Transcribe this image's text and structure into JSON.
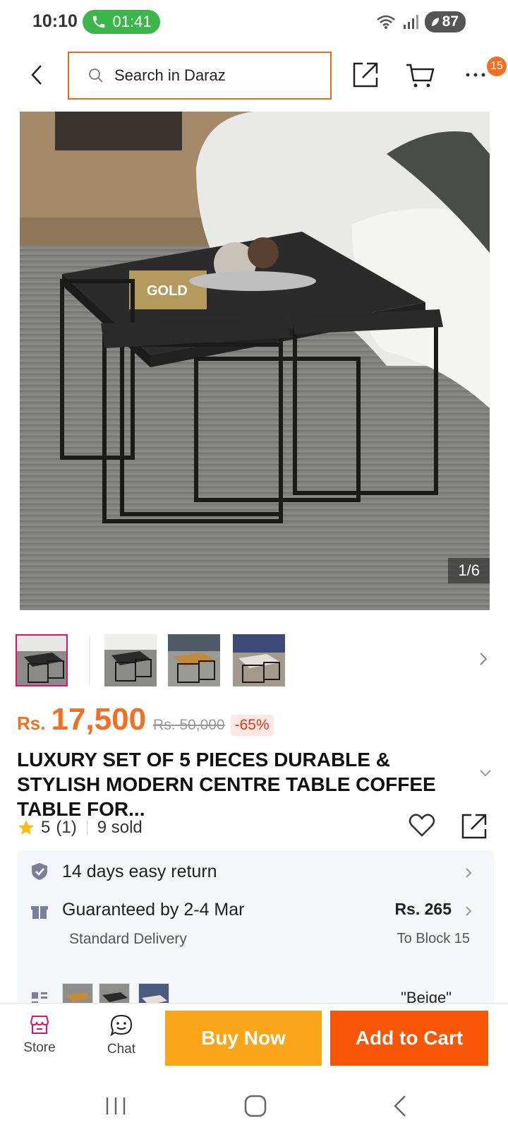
{
  "status_bar": {
    "time": "10:10",
    "call_duration": "01:41",
    "battery": "87"
  },
  "header": {
    "search_placeholder": "Search in Daraz",
    "more_badge": "15"
  },
  "gallery": {
    "counter": "1/6"
  },
  "product": {
    "currency": "Rs.",
    "price": "17,500",
    "original_price": "Rs. 50,000",
    "discount": "-65%",
    "title": "LUXURY SET OF 5 PIECES DURABLE & STYLISH MODERN CENTRE TABLE COFFEE TABLE FOR...",
    "rating": "5",
    "rating_count": "(1)",
    "sold": "9 sold"
  },
  "info": {
    "return_text": "14 days easy return",
    "delivery_text": "Guaranteed by 2-4 Mar",
    "delivery_type": "Standard Delivery",
    "delivery_price": "Rs. 265",
    "delivery_location": "To Block 15",
    "variant_label": "\"Beige\""
  },
  "actions": {
    "store_label": "Store",
    "chat_label": "Chat",
    "buy_now_label": "Buy Now",
    "add_to_cart_label": "Add to Cart"
  },
  "colors": {
    "brand_orange": "#f85606",
    "buy_now_yellow": "#fba51a",
    "price_orange": "#f36f21",
    "call_green": "#3cb54a",
    "store_pink": "#e0106b"
  }
}
